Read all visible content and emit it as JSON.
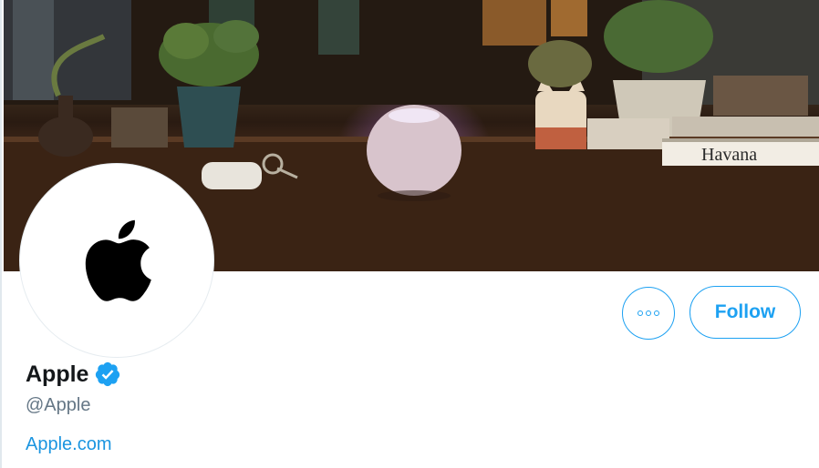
{
  "profile": {
    "display_name": "Apple",
    "handle": "@Apple",
    "website": "Apple.com",
    "verified": true
  },
  "actions": {
    "follow_label": "Follow",
    "more_icon": "more-horizontal-icon"
  },
  "banner": {
    "book_spine_text": "Havana"
  },
  "colors": {
    "accent": "#1da1f2",
    "link": "#1b95e0",
    "name_text": "#14171a",
    "secondary_text": "#657786",
    "verified_badge": "#1da1f2"
  }
}
